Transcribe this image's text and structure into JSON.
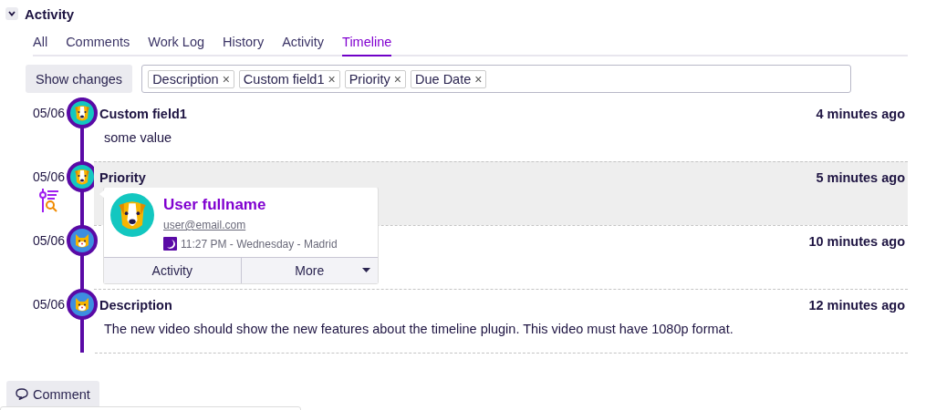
{
  "section": {
    "title": "Activity",
    "expanded": true
  },
  "tabs": [
    {
      "label": "All",
      "selected": false
    },
    {
      "label": "Comments",
      "selected": false
    },
    {
      "label": "Work Log",
      "selected": false
    },
    {
      "label": "History",
      "selected": false
    },
    {
      "label": "Activity",
      "selected": false
    },
    {
      "label": "Timeline",
      "selected": true
    }
  ],
  "filter": {
    "button": "Show changes",
    "tags": [
      "Description",
      "Custom field1",
      "Priority",
      "Due Date"
    ],
    "remove_mark": "×"
  },
  "entries": [
    {
      "date": "05/06",
      "avatar": {
        "kind": "dog"
      },
      "title": "Custom field1",
      "time": "4 minutes ago",
      "content": "some value",
      "highlighted": false,
      "filtered": false
    },
    {
      "date": "05/06",
      "avatar": {
        "kind": "dog"
      },
      "title": "Priority",
      "time": "5 minutes ago",
      "highlighted": true,
      "filtered": true
    },
    {
      "date": "05/06",
      "avatar": {
        "kind": "cat"
      },
      "time": "10 minutes ago",
      "highlighted": false,
      "filtered": false
    },
    {
      "date": "05/06",
      "avatar": {
        "kind": "cat"
      },
      "title": "Description",
      "time": "12 minutes ago",
      "content": "The new video should show the new features about the timeline plugin. This video must have 1080p format.",
      "highlighted": false,
      "filtered": false
    }
  ],
  "user_card": {
    "avatar": {
      "kind": "dog"
    },
    "name": "User fullname",
    "email": "user@email.com",
    "local_time": "11:27 PM - Wednesday - Madrid",
    "buttons": [
      "Activity",
      "More"
    ]
  },
  "comment_button": "Comment"
}
